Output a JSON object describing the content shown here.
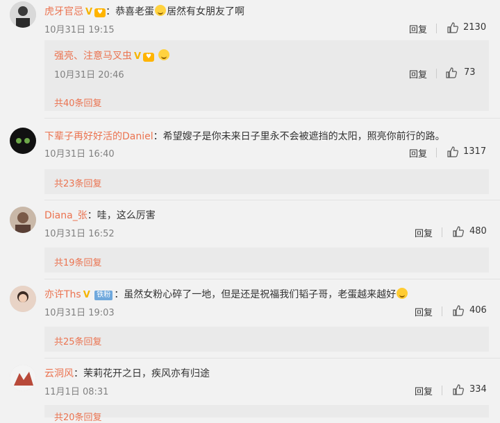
{
  "comments": [
    {
      "user": "虎牙官忌",
      "text_a": "恭喜老蛋",
      "text_b": "居然有女朋友了啊",
      "time": "10月31日 19:15",
      "reply": "回复",
      "likes": "2130"
    },
    {
      "user": "下辈子再好好活的Daniel",
      "text": "希望嫂子是你未来日子里永不会被遮挡的太阳，照亮你前行的路。",
      "time": "10月31日 16:40",
      "reply": "回复",
      "likes": "1317",
      "more": "共23条回复"
    },
    {
      "user": "Diana_张",
      "text": "哇，这么厉害",
      "time": "10月31日 16:52",
      "reply": "回复",
      "likes": "480",
      "more": "共19条回复"
    },
    {
      "user": "亦许Ths",
      "tag": "铁粉",
      "text": "虽然女粉心碎了一地，但是还是祝福我们韬子哥，老蛋越来越好",
      "time": "10月31日 19:03",
      "reply": "回复",
      "likes": "406",
      "more": "共25条回复"
    },
    {
      "user": "云洞风",
      "text": "茉莉花开之日，疾风亦有归途",
      "time": "11月1日 08:31",
      "reply": "回复",
      "likes": "334",
      "more": "共20条回复"
    }
  ],
  "subreply": {
    "user": "强亮、注意马叉虫",
    "time": "10月31日 20:46",
    "reply": "回复",
    "likes": "73",
    "more": "共40条回复"
  },
  "colors": {
    "username": "#eb7350",
    "background": "#f2f2f2",
    "vip": "#f5b400"
  },
  "icons": [
    "thumb-up-icon",
    "vip-icon",
    "fan-badge-icon",
    "emoji-icon"
  ]
}
